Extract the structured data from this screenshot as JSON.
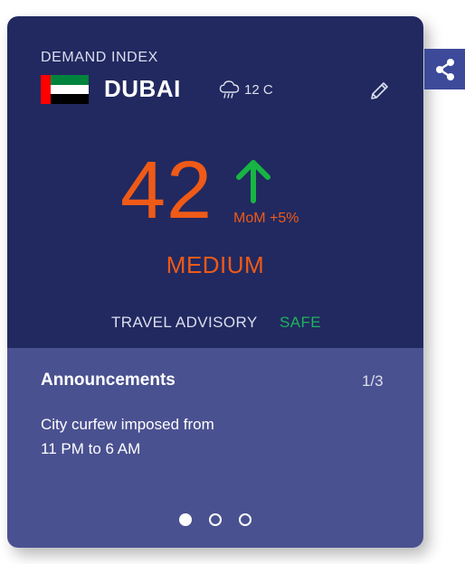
{
  "header": {
    "section_label": "DEMAND INDEX",
    "city": "DUBAI",
    "flag_icon": "uae-flag-icon",
    "weather_icon": "rain-cloud-icon",
    "temperature": "12 C",
    "edit_icon": "pencil-icon"
  },
  "index": {
    "score": "42",
    "trend_icon": "arrow-up-icon",
    "change": "MoM +5%",
    "level": "MEDIUM"
  },
  "advisory": {
    "label": "TRAVEL ADVISORY",
    "status": "SAFE"
  },
  "announcements": {
    "title": "Announcements",
    "counter": "1/3",
    "line1": "City curfew imposed from",
    "line2": "11 PM to 6 AM",
    "total": 3,
    "active": 1
  },
  "share_icon": "share-icon",
  "colors": {
    "card_top": "#212960",
    "card_bottom": "#4a5190",
    "accent": "#ef5a17",
    "safe": "#1db35c",
    "trend": "#17b544",
    "share_bg": "#3d4a9a"
  }
}
